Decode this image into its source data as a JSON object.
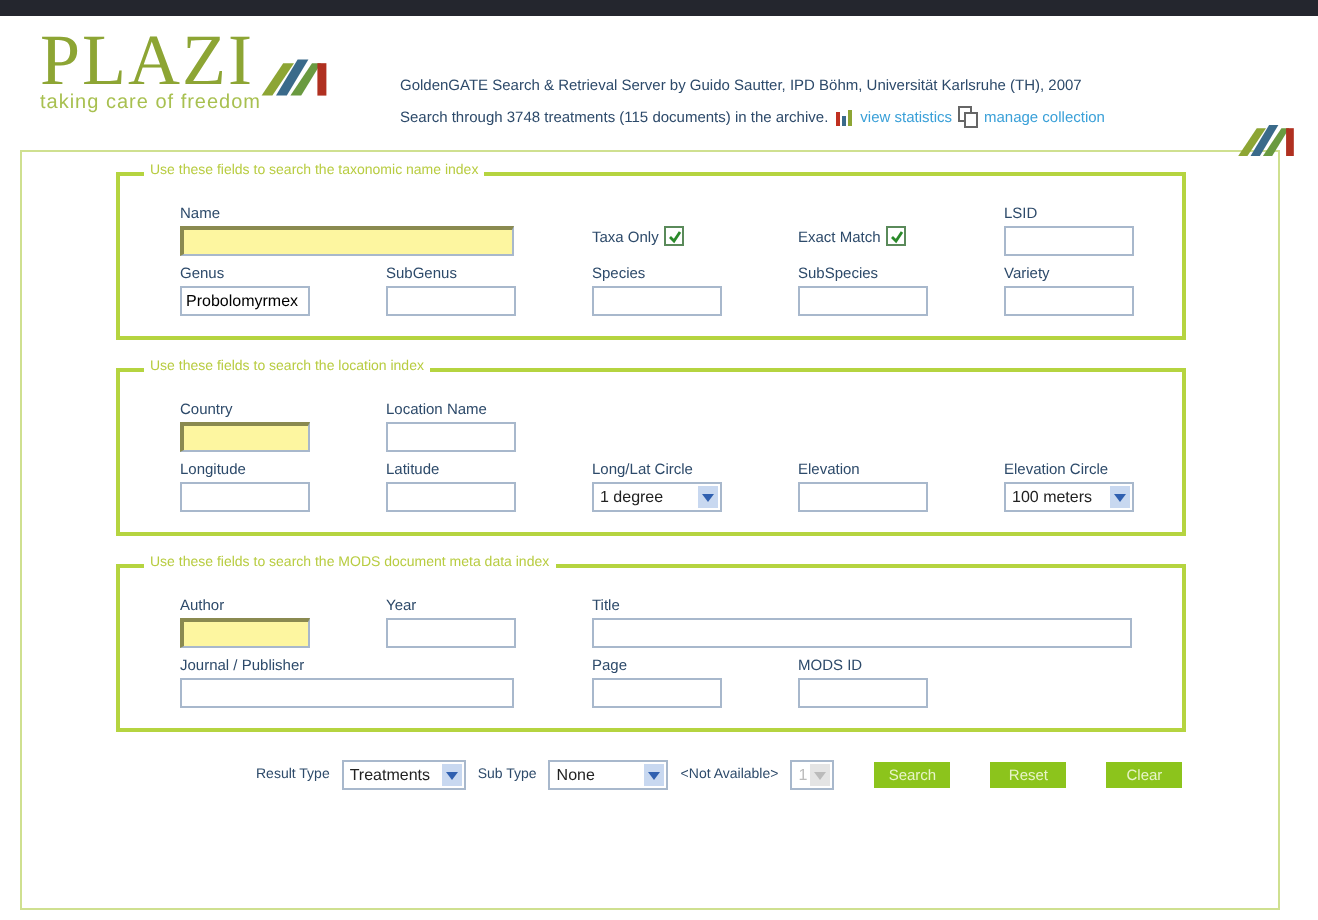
{
  "header": {
    "logo": "PLAZI",
    "tagline": "taking care of freedom",
    "credit": "GoldenGATE Search & Retrieval Server by Guido Sautter, IPD Böhm, Universität Karlsruhe (TH), 2007",
    "summary": "Search through 3748 treatments (115 documents) in the archive.",
    "links": [
      {
        "kind": "statistics",
        "label": "view statistics"
      },
      {
        "kind": "collection",
        "label": "manage collection"
      }
    ]
  },
  "sections": [
    {
      "legend": "Use these fields to search the taxonomic name index",
      "rows": [
        [
          {
            "kind": "wide-text",
            "label": "Name",
            "highlighted": true
          },
          "",
          {
            "kind": "checkbox",
            "label": "Taxa Only",
            "checked": true
          },
          {
            "kind": "checkbox",
            "label": "Exact Match",
            "checked": true
          },
          {
            "kind": "text",
            "label": "LSID",
            "highlighted": false
          }
        ],
        [
          {
            "kind": "text",
            "label": "Genus",
            "value": "Probolomyrmex",
            "highlighted": false
          },
          {
            "kind": "text",
            "label": "SubGenus",
            "highlighted": false
          },
          {
            "kind": "text",
            "label": "Species",
            "highlighted": false
          },
          {
            "kind": "text",
            "label": "SubSpecies",
            "highlighted": false
          },
          {
            "kind": "text",
            "label": "Variety",
            "highlighted": false
          }
        ]
      ]
    },
    {
      "legend": "Use these fields to search the location index",
      "rows": [
        [
          {
            "kind": "text",
            "label": "Country",
            "highlighted": true
          },
          {
            "kind": "text",
            "label": "Location Name",
            "highlighted": false
          }
        ],
        [
          {
            "kind": "text",
            "label": "Longitude",
            "highlighted": false
          },
          {
            "kind": "text",
            "label": "Latitude",
            "highlighted": false
          },
          {
            "kind": "select",
            "label": "Long/Lat Circle",
            "value": "1 degree"
          },
          {
            "kind": "text",
            "label": "Elevation",
            "highlighted": false
          },
          {
            "kind": "select",
            "label": "Elevation Circle",
            "value": "100 meters"
          }
        ]
      ]
    },
    {
      "legend": "Use these fields to search the MODS document meta data index",
      "rows": [
        [
          {
            "kind": "text",
            "label": "Author",
            "highlighted": true
          },
          {
            "kind": "text",
            "label": "Year",
            "highlighted": false
          },
          {
            "kind": "long-text",
            "label": "Title",
            "highlighted": false
          },
          "",
          ""
        ],
        [
          {
            "kind": "wide-text",
            "label": "Journal / Publisher",
            "highlighted": false
          },
          "",
          {
            "kind": "text",
            "label": "Page",
            "highlighted": false
          },
          {
            "kind": "text",
            "label": "MODS ID",
            "highlighted": false
          }
        ]
      ]
    }
  ],
  "footer": {
    "controls": [
      {
        "kind": "label",
        "text": "Result Type"
      },
      {
        "kind": "select",
        "value": "Treatments",
        "disabled": false
      },
      {
        "kind": "label",
        "text": "Sub Type"
      },
      {
        "kind": "select",
        "value": "None",
        "disabled": false
      },
      {
        "kind": "label",
        "text": "<Not Available>"
      },
      {
        "kind": "select",
        "value": "1",
        "disabled": true
      }
    ],
    "buttons": [
      "Search",
      "Reset",
      "Clear"
    ]
  }
}
